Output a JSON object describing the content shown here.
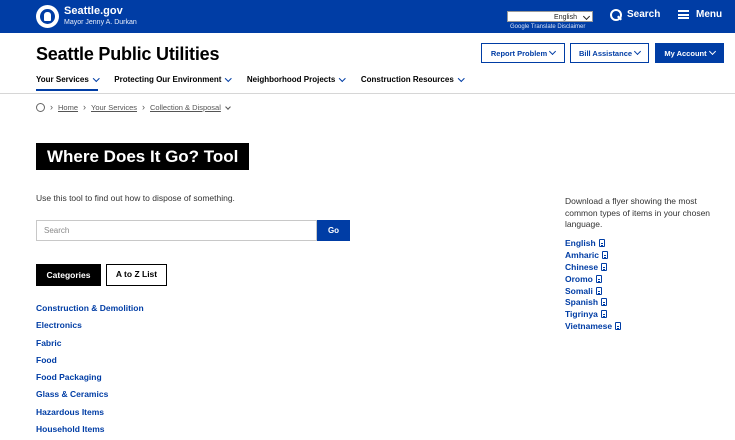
{
  "topbar": {
    "site_name": "Seattle.gov",
    "mayor": "Mayor Jenny A. Durkan",
    "language_selected": "English",
    "translate_disclaimer": "Google Translate Disclaimer",
    "search_label": "Search",
    "menu_label": "Menu",
    "bar_color": "#003da5"
  },
  "header": {
    "department": "Seattle Public Utilities",
    "buttons": {
      "report_problem": "Report Problem",
      "bill_assistance": "Bill Assistance",
      "my_account": "My Account"
    }
  },
  "nav": {
    "items": [
      "Your Services",
      "Protecting Our Environment",
      "Neighborhood Projects",
      "Construction Resources"
    ]
  },
  "breadcrumb": {
    "items": [
      "Home",
      "Your Services",
      "Collection & Disposal"
    ]
  },
  "main": {
    "title": "Where Does It Go? Tool",
    "intro": "Use this tool to find out how to dispose of something.",
    "search_placeholder": "Search",
    "go_label": "Go",
    "tabs": [
      "Categories",
      "A to Z List"
    ],
    "categories": [
      "Construction & Demolition",
      "Electronics",
      "Fabric",
      "Food",
      "Food Packaging",
      "Glass & Ceramics",
      "Hazardous Items",
      "Household Items"
    ]
  },
  "sidebar": {
    "intro": "Download a flyer showing the most common types of items in your chosen language.",
    "languages": [
      "English",
      "Amharic",
      "Chinese",
      "Oromo",
      "Somali",
      "Spanish",
      "Tigrinya",
      "Vietnamese"
    ]
  }
}
